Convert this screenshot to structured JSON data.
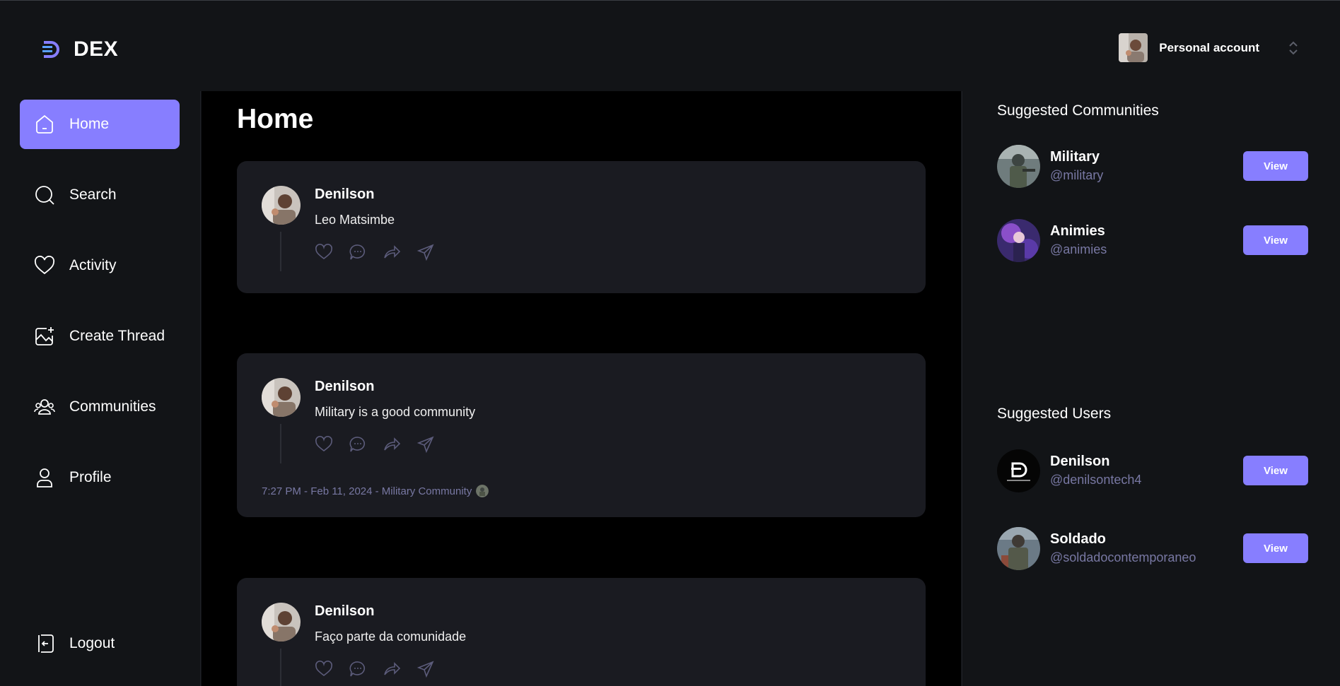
{
  "app": {
    "name": "DEX"
  },
  "account": {
    "label": "Personal account"
  },
  "nav": {
    "items": [
      {
        "label": "Home",
        "icon": "home-icon",
        "active": true
      },
      {
        "label": "Search",
        "icon": "search-icon"
      },
      {
        "label": "Activity",
        "icon": "heart-icon"
      },
      {
        "label": "Create Thread",
        "icon": "create-image-icon"
      },
      {
        "label": "Communities",
        "icon": "users-icon"
      },
      {
        "label": "Profile",
        "icon": "user-icon"
      }
    ],
    "logout": "Logout"
  },
  "main": {
    "title": "Home",
    "threads": [
      {
        "author": "Denilson",
        "text": "Leo Matsimbe"
      },
      {
        "author": "Denilson",
        "text": "Military is a good community",
        "meta": "7:27 PM - Feb 11, 2024 - Military Community"
      },
      {
        "author": "Denilson",
        "text": "Faço parte da comunidade"
      }
    ]
  },
  "suggested_communities": {
    "title": "Suggested Communities",
    "items": [
      {
        "name": "Military",
        "handle": "@military",
        "button": "View"
      },
      {
        "name": "Animies",
        "handle": "@animies",
        "button": "View"
      }
    ]
  },
  "suggested_users": {
    "title": "Suggested Users",
    "items": [
      {
        "name": "Denilson",
        "handle": "@denilsontech4",
        "button": "View"
      },
      {
        "name": "Soldado",
        "handle": "@soldadocontemporaneo",
        "button": "View"
      }
    ]
  },
  "colors": {
    "accent": "#877eff",
    "background": "#121417",
    "feed": "#000000",
    "card": "#1a1b21",
    "muted": "#7878a3"
  }
}
